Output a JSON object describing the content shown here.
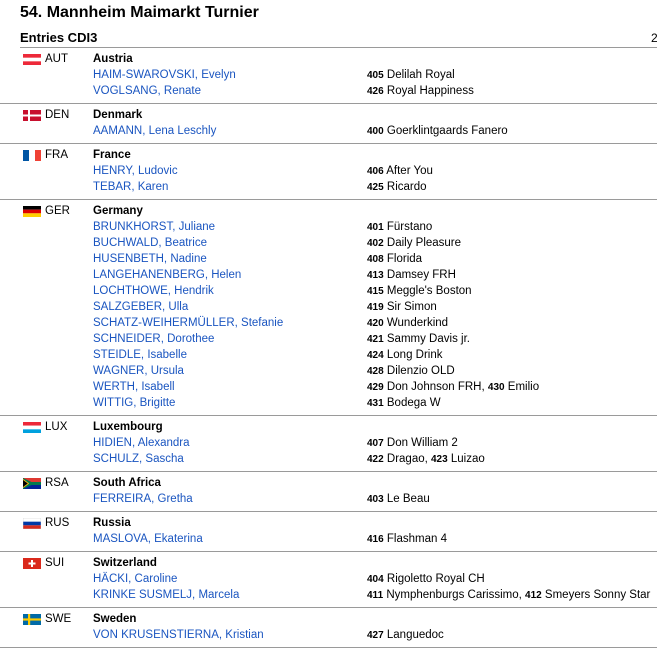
{
  "title": "54. Mannheim Maimarkt Turnier",
  "subtitle": "Entries CDI3",
  "edge_mark": "2",
  "groups": [
    {
      "code": "AUT",
      "country": "Austria",
      "flag": "aut",
      "entries": [
        {
          "rider": "HAIM-SWAROVSKI, Evelyn",
          "horses": [
            {
              "num": "405",
              "name": "Delilah Royal"
            }
          ]
        },
        {
          "rider": "VOGLSANG, Renate",
          "horses": [
            {
              "num": "426",
              "name": "Royal Happiness"
            }
          ]
        }
      ]
    },
    {
      "code": "DEN",
      "country": "Denmark",
      "flag": "den",
      "entries": [
        {
          "rider": "AAMANN, Lena Leschly",
          "horses": [
            {
              "num": "400",
              "name": "Goerklintgaards Fanero"
            }
          ]
        }
      ]
    },
    {
      "code": "FRA",
      "country": "France",
      "flag": "fra",
      "entries": [
        {
          "rider": "HENRY, Ludovic",
          "horses": [
            {
              "num": "406",
              "name": "After You"
            }
          ]
        },
        {
          "rider": "TEBAR, Karen",
          "horses": [
            {
              "num": "425",
              "name": "Ricardo"
            }
          ]
        }
      ]
    },
    {
      "code": "GER",
      "country": "Germany",
      "flag": "ger",
      "entries": [
        {
          "rider": "BRUNKHORST, Juliane",
          "horses": [
            {
              "num": "401",
              "name": "Fürstano"
            }
          ]
        },
        {
          "rider": "BUCHWALD, Beatrice",
          "horses": [
            {
              "num": "402",
              "name": "Daily Pleasure"
            }
          ]
        },
        {
          "rider": "HUSENBETH, Nadine",
          "horses": [
            {
              "num": "408",
              "name": "Florida"
            }
          ]
        },
        {
          "rider": "LANGEHANENBERG, Helen",
          "horses": [
            {
              "num": "413",
              "name": "Damsey FRH"
            }
          ]
        },
        {
          "rider": "LOCHTHOWE, Hendrik",
          "horses": [
            {
              "num": "415",
              "name": "Meggle's Boston"
            }
          ]
        },
        {
          "rider": "SALZGEBER, Ulla",
          "horses": [
            {
              "num": "419",
              "name": "Sir Simon"
            }
          ]
        },
        {
          "rider": "SCHATZ-WEIHERMÜLLER, Stefanie",
          "horses": [
            {
              "num": "420",
              "name": "Wunderkind"
            }
          ]
        },
        {
          "rider": "SCHNEIDER, Dorothee",
          "horses": [
            {
              "num": "421",
              "name": "Sammy Davis jr."
            }
          ]
        },
        {
          "rider": "STEIDLE, Isabelle",
          "horses": [
            {
              "num": "424",
              "name": "Long Drink"
            }
          ]
        },
        {
          "rider": "WAGNER, Ursula",
          "horses": [
            {
              "num": "428",
              "name": "Dilenzio OLD"
            }
          ]
        },
        {
          "rider": "WERTH, Isabell",
          "horses": [
            {
              "num": "429",
              "name": "Don Johnson FRH"
            },
            {
              "num": "430",
              "name": "Emilio"
            }
          ]
        },
        {
          "rider": "WITTIG, Brigitte",
          "horses": [
            {
              "num": "431",
              "name": "Bodega W"
            }
          ]
        }
      ]
    },
    {
      "code": "LUX",
      "country": "Luxembourg",
      "flag": "lux",
      "entries": [
        {
          "rider": "HIDIEN, Alexandra",
          "horses": [
            {
              "num": "407",
              "name": "Don William 2"
            }
          ]
        },
        {
          "rider": "SCHULZ, Sascha",
          "horses": [
            {
              "num": "422",
              "name": "Dragao"
            },
            {
              "num": "423",
              "name": "Luizao"
            }
          ]
        }
      ]
    },
    {
      "code": "RSA",
      "country": "South Africa",
      "flag": "rsa",
      "entries": [
        {
          "rider": "FERREIRA, Gretha",
          "horses": [
            {
              "num": "403",
              "name": "Le Beau"
            }
          ]
        }
      ]
    },
    {
      "code": "RUS",
      "country": "Russia",
      "flag": "rus",
      "entries": [
        {
          "rider": "MASLOVA, Ekaterina",
          "horses": [
            {
              "num": "416",
              "name": "Flashman 4"
            }
          ]
        }
      ]
    },
    {
      "code": "SUI",
      "country": "Switzerland",
      "flag": "sui",
      "entries": [
        {
          "rider": "HÄCKI, Caroline",
          "horses": [
            {
              "num": "404",
              "name": "Rigoletto Royal CH"
            }
          ]
        },
        {
          "rider": "KRINKE SUSMELJ, Marcela",
          "horses": [
            {
              "num": "411",
              "name": "Nymphenburgs Carissimo"
            },
            {
              "num": "412",
              "name": "Smeyers Sonny Star"
            }
          ]
        }
      ]
    },
    {
      "code": "SWE",
      "country": "Sweden",
      "flag": "swe",
      "entries": [
        {
          "rider": "VON KRUSENSTIERNA, Kristian",
          "horses": [
            {
              "num": "427",
              "name": "Languedoc"
            }
          ]
        }
      ]
    }
  ]
}
